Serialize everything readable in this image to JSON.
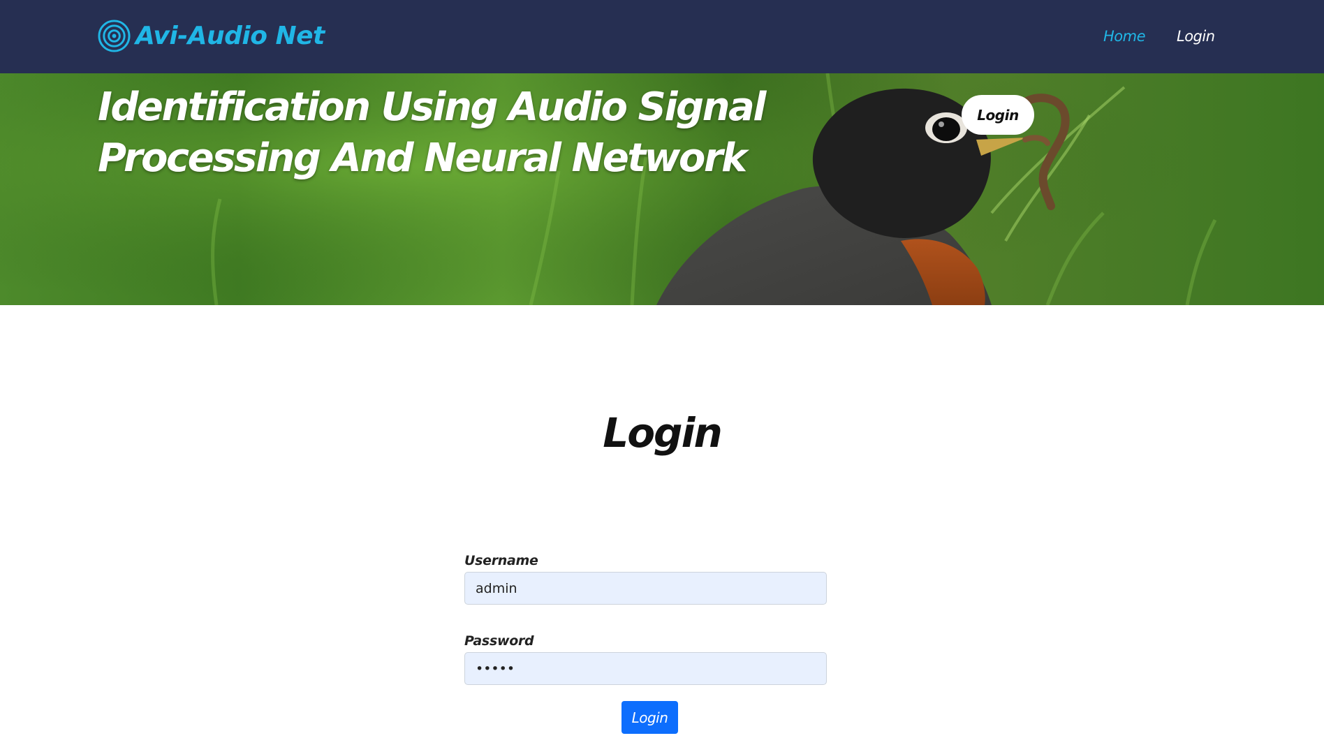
{
  "navbar": {
    "brand": "Avi-Audio Net",
    "brand_color": "#20b6e6",
    "background": "#262f52",
    "links": [
      {
        "label": "Home",
        "active": true
      },
      {
        "label": "Login",
        "active": false
      }
    ]
  },
  "hero": {
    "title_lines": [
      "Identification Using Audio Signal",
      "Processing And Neural Network"
    ],
    "login_button": "Login",
    "image": "robin-bird-on-grass"
  },
  "login": {
    "heading": "Login",
    "username": {
      "label": "Username",
      "value": "admin"
    },
    "password": {
      "label": "Password",
      "value": "•••••"
    },
    "submit": "Login",
    "submit_color": "#0d6efd"
  }
}
